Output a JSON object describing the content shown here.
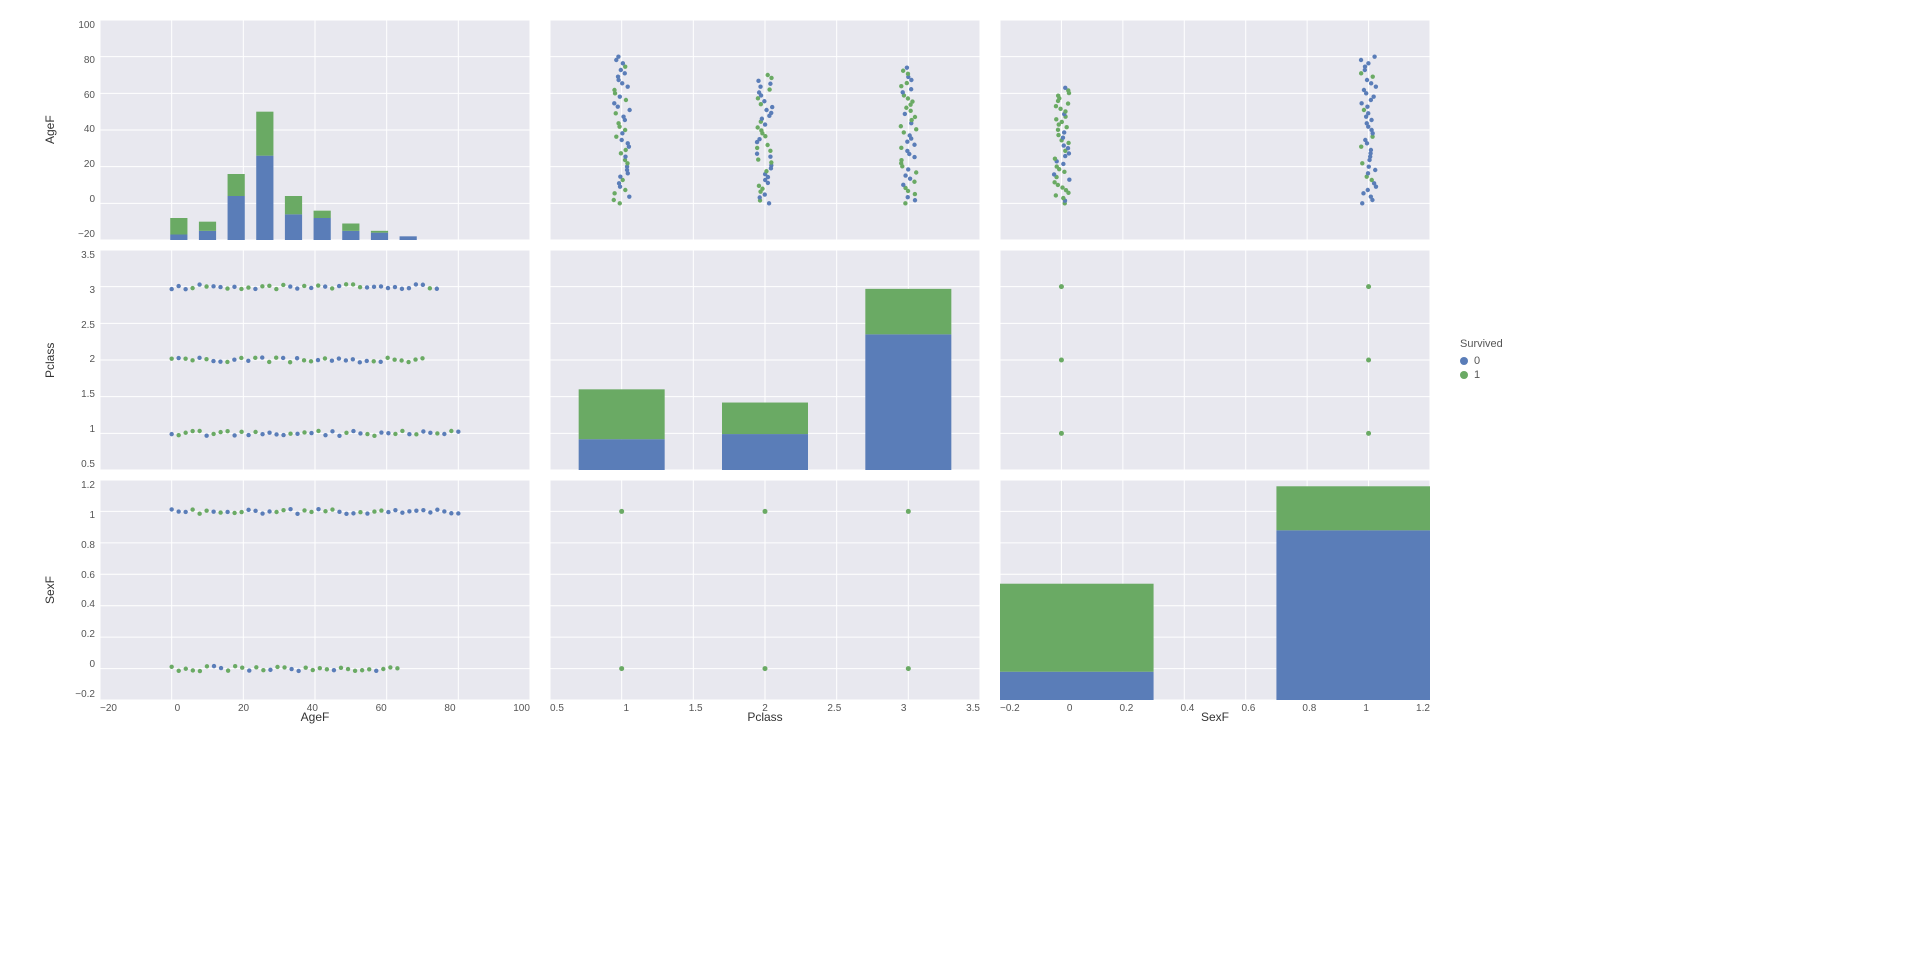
{
  "legend": {
    "title": "Survived",
    "items": [
      "0",
      "1"
    ]
  },
  "variables": [
    "AgeF",
    "Pclass",
    "SexF"
  ],
  "colors": {
    "survived0": "#5a7db8",
    "survived1": "#6aaa64"
  },
  "chart_data": [
    {
      "type": "bar",
      "variable_x": "AgeF",
      "variable_y": "AgeF",
      "xlabel": "",
      "ylabel": "AgeF",
      "xlim": [
        -20,
        100
      ],
      "ylim": [
        -20,
        100
      ],
      "xticks": [
        -20,
        0,
        20,
        40,
        60,
        80,
        100
      ],
      "yticks": [
        -20,
        0,
        20,
        40,
        60,
        80,
        100
      ],
      "bin_centers": [
        2,
        10,
        18,
        26,
        34,
        42,
        50,
        58,
        66,
        74,
        82
      ],
      "series": [
        {
          "name": "0",
          "values": [
            -17,
            -15,
            4,
            26,
            -6,
            -8,
            -15,
            -16,
            -18,
            -20,
            -20
          ]
        },
        {
          "name": "1",
          "values": [
            -8,
            -10,
            16,
            50,
            4,
            -4,
            -11,
            -15,
            -18,
            -20,
            -20
          ]
        }
      ],
      "note": "bars drawn from bottom of range; series stacked (0 then 1 on top)"
    },
    {
      "type": "scatter",
      "variable_x": "Pclass",
      "variable_y": "AgeF",
      "xlim": [
        0.5,
        3.5
      ],
      "ylim": [
        -20,
        100
      ],
      "xticks": [
        0.5,
        1.0,
        1.5,
        2.0,
        2.5,
        3.0,
        3.5
      ],
      "yticks": [
        -20,
        0,
        20,
        40,
        60,
        80,
        100
      ],
      "strip_columns": [
        {
          "x": 1,
          "y_range": [
            0,
            80
          ],
          "mix": "both"
        },
        {
          "x": 2,
          "y_range": [
            0,
            70
          ],
          "mix": "both"
        },
        {
          "x": 3,
          "y_range": [
            0,
            74
          ],
          "mix": "both"
        }
      ]
    },
    {
      "type": "scatter",
      "variable_x": "SexF",
      "variable_y": "AgeF",
      "xlim": [
        -0.2,
        1.2
      ],
      "ylim": [
        -20,
        100
      ],
      "xticks": [
        -0.2,
        0.0,
        0.2,
        0.4,
        0.6,
        0.8,
        1.0,
        1.2
      ],
      "yticks": [
        -20,
        0,
        20,
        40,
        60,
        80,
        100
      ],
      "strip_columns": [
        {
          "x": 0,
          "y_range": [
            0,
            63
          ],
          "mix": "mostly1"
        },
        {
          "x": 1,
          "y_range": [
            0,
            80
          ],
          "mix": "mostly0"
        }
      ]
    },
    {
      "type": "scatter",
      "variable_x": "AgeF",
      "variable_y": "Pclass",
      "xlim": [
        -20,
        100
      ],
      "ylim": [
        0.5,
        3.5
      ],
      "xticks": [
        -20,
        0,
        20,
        40,
        60,
        80,
        100
      ],
      "yticks": [
        0.5,
        1.0,
        1.5,
        2.0,
        2.5,
        3.0,
        3.5
      ],
      "strip_rows": [
        {
          "y": 3,
          "x_range": [
            0,
            74
          ],
          "mix": "mostly0_after50"
        },
        {
          "y": 2,
          "x_range": [
            0,
            70
          ],
          "mix": "both"
        },
        {
          "y": 1,
          "x_range": [
            0,
            80
          ],
          "mix": "both"
        }
      ]
    },
    {
      "type": "bar",
      "variable_x": "Pclass",
      "variable_y": "Pclass",
      "xlim": [
        0.5,
        3.5
      ],
      "ylim": [
        0.5,
        3.5
      ],
      "xticks": [
        0.5,
        1.0,
        1.5,
        2.0,
        2.5,
        3.0,
        3.5
      ],
      "yticks": [
        0.5,
        1.0,
        1.5,
        2.0,
        2.5,
        3.0,
        3.5
      ],
      "bin_centers": [
        1,
        2,
        3
      ],
      "series": [
        {
          "name": "0",
          "values": [
            0.92,
            0.99,
            2.35
          ]
        },
        {
          "name": "1",
          "values": [
            1.6,
            1.42,
            2.97
          ]
        }
      ]
    },
    {
      "type": "scatter",
      "variable_x": "SexF",
      "variable_y": "Pclass",
      "xlim": [
        -0.2,
        1.2
      ],
      "ylim": [
        0.5,
        3.5
      ],
      "xticks": [
        -0.2,
        0.0,
        0.2,
        0.4,
        0.6,
        0.8,
        1.0,
        1.2
      ],
      "yticks": [
        0.5,
        1.0,
        1.5,
        2.0,
        2.5,
        3.0,
        3.5
      ],
      "points": [
        {
          "x": 0,
          "y": 1,
          "class": 1
        },
        {
          "x": 0,
          "y": 2,
          "class": 1
        },
        {
          "x": 0,
          "y": 3,
          "class": 1
        },
        {
          "x": 1,
          "y": 1,
          "class": 1
        },
        {
          "x": 1,
          "y": 2,
          "class": 1
        },
        {
          "x": 1,
          "y": 3,
          "class": 1
        }
      ]
    },
    {
      "type": "scatter",
      "variable_x": "AgeF",
      "variable_y": "SexF",
      "xlim": [
        -20,
        100
      ],
      "ylim": [
        -0.2,
        1.2
      ],
      "xticks": [
        -20,
        0,
        20,
        40,
        60,
        80,
        100
      ],
      "yticks": [
        -0.2,
        0.0,
        0.2,
        0.4,
        0.6,
        0.8,
        1.0,
        1.2
      ],
      "strip_rows": [
        {
          "y": 1,
          "x_range": [
            0,
            80
          ],
          "mix": "both_blue_late"
        },
        {
          "y": 0,
          "x_range": [
            0,
            63
          ],
          "mix": "mostly1"
        }
      ]
    },
    {
      "type": "scatter",
      "variable_x": "Pclass",
      "variable_y": "SexF",
      "xlim": [
        0.5,
        3.5
      ],
      "ylim": [
        -0.2,
        1.2
      ],
      "xticks": [
        0.5,
        1.0,
        1.5,
        2.0,
        2.5,
        3.0,
        3.5
      ],
      "yticks": [
        -0.2,
        0.0,
        0.2,
        0.4,
        0.6,
        0.8,
        1.0,
        1.2
      ],
      "points": [
        {
          "x": 1,
          "y": 0,
          "class": 1
        },
        {
          "x": 1,
          "y": 1,
          "class": 1
        },
        {
          "x": 2,
          "y": 0,
          "class": 1
        },
        {
          "x": 2,
          "y": 1,
          "class": 1
        },
        {
          "x": 3,
          "y": 0,
          "class": 1
        },
        {
          "x": 3,
          "y": 1,
          "class": 1
        }
      ]
    },
    {
      "type": "bar",
      "variable_x": "SexF",
      "variable_y": "SexF",
      "xlim": [
        -0.2,
        1.2
      ],
      "ylim": [
        -0.2,
        1.2
      ],
      "xticks": [
        -0.2,
        0.0,
        0.2,
        0.4,
        0.6,
        0.8,
        1.0,
        1.2
      ],
      "yticks": [
        -0.2,
        0.0,
        0.2,
        0.4,
        0.6,
        0.8,
        1.0,
        1.2
      ],
      "bin_centers": [
        0,
        1
      ],
      "series": [
        {
          "name": "0",
          "values": [
            -0.02,
            0.88
          ]
        },
        {
          "name": "1",
          "values": [
            0.54,
            1.16
          ]
        }
      ]
    }
  ]
}
